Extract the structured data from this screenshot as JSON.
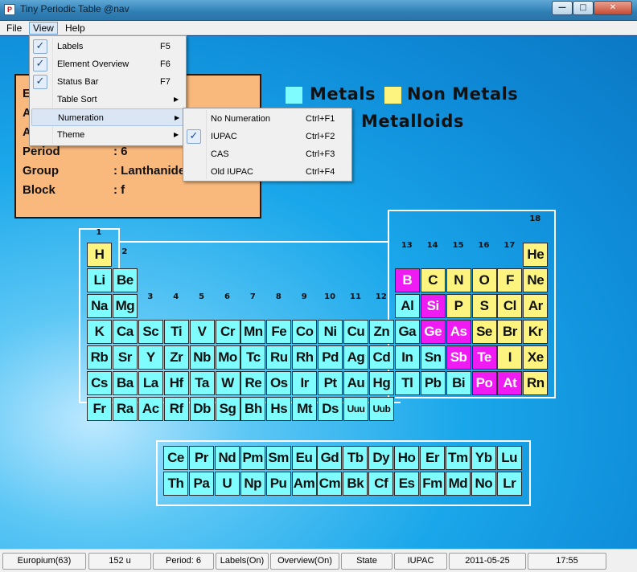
{
  "window": {
    "title": "Tiny Periodic Table   @nav",
    "app_icon": "P",
    "min": "—",
    "max": "□",
    "close": "✕"
  },
  "menubar": {
    "file": "File",
    "view": "View",
    "help": "Help"
  },
  "view_menu": [
    {
      "label": "Labels",
      "shortcut": "F5",
      "checked": true,
      "submenu": false
    },
    {
      "label": "Element Overview",
      "shortcut": "F6",
      "checked": true,
      "submenu": false
    },
    {
      "label": "Status Bar",
      "shortcut": "F7",
      "checked": true,
      "submenu": false
    },
    {
      "label": "Table Sort",
      "shortcut": "",
      "checked": false,
      "submenu": true
    },
    {
      "label": "Numeration",
      "shortcut": "",
      "checked": false,
      "submenu": true,
      "highlighted": true
    },
    {
      "label": "Theme",
      "shortcut": "",
      "checked": false,
      "submenu": true
    }
  ],
  "numeration_menu": [
    {
      "label": "No Numeration",
      "shortcut": "Ctrl+F1",
      "checked": false
    },
    {
      "label": "IUPAC",
      "shortcut": "Ctrl+F2",
      "checked": true
    },
    {
      "label": "CAS",
      "shortcut": "Ctrl+F3",
      "checked": false
    },
    {
      "label": "Old IUPAC",
      "shortcut": "Ctrl+F4",
      "checked": false
    }
  ],
  "info_panel": {
    "rows": [
      {
        "key": "E",
        "value": ""
      },
      {
        "key": "A",
        "value": ""
      },
      {
        "key": "A",
        "value": ""
      },
      {
        "key": "Period",
        "value": ": 6"
      },
      {
        "key": "Group",
        "value": ": Lanthanide"
      },
      {
        "key": "Block",
        "value": ": f"
      }
    ]
  },
  "legend": {
    "metals": "Metals",
    "nonmetals": "Non Metals",
    "metalloids": "Metalloids",
    "colors": {
      "metal": "#7ffcfd",
      "nonmetal": "#fcf47f",
      "metalloid": "#ee1cf3"
    }
  },
  "group_numbers": [
    "1",
    "2",
    "3",
    "4",
    "5",
    "6",
    "7",
    "8",
    "9",
    "10",
    "11",
    "12",
    "13",
    "14",
    "15",
    "16",
    "17",
    "18"
  ],
  "periodic_table": [
    {
      "symbol": "H",
      "group": 1,
      "period": 1,
      "category": "nonmetal"
    },
    {
      "symbol": "He",
      "group": 18,
      "period": 1,
      "category": "nonmetal"
    },
    {
      "symbol": "Li",
      "group": 1,
      "period": 2,
      "category": "metal"
    },
    {
      "symbol": "Be",
      "group": 2,
      "period": 2,
      "category": "metal"
    },
    {
      "symbol": "B",
      "group": 13,
      "period": 2,
      "category": "metalloid"
    },
    {
      "symbol": "C",
      "group": 14,
      "period": 2,
      "category": "nonmetal"
    },
    {
      "symbol": "N",
      "group": 15,
      "period": 2,
      "category": "nonmetal"
    },
    {
      "symbol": "O",
      "group": 16,
      "period": 2,
      "category": "nonmetal"
    },
    {
      "symbol": "F",
      "group": 17,
      "period": 2,
      "category": "nonmetal"
    },
    {
      "symbol": "Ne",
      "group": 18,
      "period": 2,
      "category": "nonmetal"
    },
    {
      "symbol": "Na",
      "group": 1,
      "period": 3,
      "category": "metal"
    },
    {
      "symbol": "Mg",
      "group": 2,
      "period": 3,
      "category": "metal"
    },
    {
      "symbol": "Al",
      "group": 13,
      "period": 3,
      "category": "metal"
    },
    {
      "symbol": "Si",
      "group": 14,
      "period": 3,
      "category": "metalloid"
    },
    {
      "symbol": "P",
      "group": 15,
      "period": 3,
      "category": "nonmetal"
    },
    {
      "symbol": "S",
      "group": 16,
      "period": 3,
      "category": "nonmetal"
    },
    {
      "symbol": "Cl",
      "group": 17,
      "period": 3,
      "category": "nonmetal"
    },
    {
      "symbol": "Ar",
      "group": 18,
      "period": 3,
      "category": "nonmetal"
    },
    {
      "symbol": "K",
      "group": 1,
      "period": 4,
      "category": "metal"
    },
    {
      "symbol": "Ca",
      "group": 2,
      "period": 4,
      "category": "metal"
    },
    {
      "symbol": "Sc",
      "group": 3,
      "period": 4,
      "category": "metal"
    },
    {
      "symbol": "Ti",
      "group": 4,
      "period": 4,
      "category": "metal"
    },
    {
      "symbol": "V",
      "group": 5,
      "period": 4,
      "category": "metal"
    },
    {
      "symbol": "Cr",
      "group": 6,
      "period": 4,
      "category": "metal"
    },
    {
      "symbol": "Mn",
      "group": 7,
      "period": 4,
      "category": "metal"
    },
    {
      "symbol": "Fe",
      "group": 8,
      "period": 4,
      "category": "metal"
    },
    {
      "symbol": "Co",
      "group": 9,
      "period": 4,
      "category": "metal"
    },
    {
      "symbol": "Ni",
      "group": 10,
      "period": 4,
      "category": "metal"
    },
    {
      "symbol": "Cu",
      "group": 11,
      "period": 4,
      "category": "metal"
    },
    {
      "symbol": "Zn",
      "group": 12,
      "period": 4,
      "category": "metal"
    },
    {
      "symbol": "Ga",
      "group": 13,
      "period": 4,
      "category": "metal"
    },
    {
      "symbol": "Ge",
      "group": 14,
      "period": 4,
      "category": "metalloid"
    },
    {
      "symbol": "As",
      "group": 15,
      "period": 4,
      "category": "metalloid"
    },
    {
      "symbol": "Se",
      "group": 16,
      "period": 4,
      "category": "nonmetal"
    },
    {
      "symbol": "Br",
      "group": 17,
      "period": 4,
      "category": "nonmetal"
    },
    {
      "symbol": "Kr",
      "group": 18,
      "period": 4,
      "category": "nonmetal"
    },
    {
      "symbol": "Rb",
      "group": 1,
      "period": 5,
      "category": "metal"
    },
    {
      "symbol": "Sr",
      "group": 2,
      "period": 5,
      "category": "metal"
    },
    {
      "symbol": "Y",
      "group": 3,
      "period": 5,
      "category": "metal"
    },
    {
      "symbol": "Zr",
      "group": 4,
      "period": 5,
      "category": "metal"
    },
    {
      "symbol": "Nb",
      "group": 5,
      "period": 5,
      "category": "metal"
    },
    {
      "symbol": "Mo",
      "group": 6,
      "period": 5,
      "category": "metal"
    },
    {
      "symbol": "Tc",
      "group": 7,
      "period": 5,
      "category": "metal"
    },
    {
      "symbol": "Ru",
      "group": 8,
      "period": 5,
      "category": "metal"
    },
    {
      "symbol": "Rh",
      "group": 9,
      "period": 5,
      "category": "metal"
    },
    {
      "symbol": "Pd",
      "group": 10,
      "period": 5,
      "category": "metal"
    },
    {
      "symbol": "Ag",
      "group": 11,
      "period": 5,
      "category": "metal"
    },
    {
      "symbol": "Cd",
      "group": 12,
      "period": 5,
      "category": "metal"
    },
    {
      "symbol": "In",
      "group": 13,
      "period": 5,
      "category": "metal"
    },
    {
      "symbol": "Sn",
      "group": 14,
      "period": 5,
      "category": "metal"
    },
    {
      "symbol": "Sb",
      "group": 15,
      "period": 5,
      "category": "metalloid"
    },
    {
      "symbol": "Te",
      "group": 16,
      "period": 5,
      "category": "metalloid"
    },
    {
      "symbol": "I",
      "group": 17,
      "period": 5,
      "category": "nonmetal"
    },
    {
      "symbol": "Xe",
      "group": 18,
      "period": 5,
      "category": "nonmetal"
    },
    {
      "symbol": "Cs",
      "group": 1,
      "period": 6,
      "category": "metal"
    },
    {
      "symbol": "Ba",
      "group": 2,
      "period": 6,
      "category": "metal"
    },
    {
      "symbol": "La",
      "group": 3,
      "period": 6,
      "category": "metal"
    },
    {
      "symbol": "Hf",
      "group": 4,
      "period": 6,
      "category": "metal"
    },
    {
      "symbol": "Ta",
      "group": 5,
      "period": 6,
      "category": "metal"
    },
    {
      "symbol": "W",
      "group": 6,
      "period": 6,
      "category": "metal"
    },
    {
      "symbol": "Re",
      "group": 7,
      "period": 6,
      "category": "metal"
    },
    {
      "symbol": "Os",
      "group": 8,
      "period": 6,
      "category": "metal"
    },
    {
      "symbol": "Ir",
      "group": 9,
      "period": 6,
      "category": "metal"
    },
    {
      "symbol": "Pt",
      "group": 10,
      "period": 6,
      "category": "metal"
    },
    {
      "symbol": "Au",
      "group": 11,
      "period": 6,
      "category": "metal"
    },
    {
      "symbol": "Hg",
      "group": 12,
      "period": 6,
      "category": "metal"
    },
    {
      "symbol": "Tl",
      "group": 13,
      "period": 6,
      "category": "metal"
    },
    {
      "symbol": "Pb",
      "group": 14,
      "period": 6,
      "category": "metal"
    },
    {
      "symbol": "Bi",
      "group": 15,
      "period": 6,
      "category": "metal"
    },
    {
      "symbol": "Po",
      "group": 16,
      "period": 6,
      "category": "metalloid"
    },
    {
      "symbol": "At",
      "group": 17,
      "period": 6,
      "category": "metalloid"
    },
    {
      "symbol": "Rn",
      "group": 18,
      "period": 6,
      "category": "nonmetal"
    },
    {
      "symbol": "Fr",
      "group": 1,
      "period": 7,
      "category": "metal"
    },
    {
      "symbol": "Ra",
      "group": 2,
      "period": 7,
      "category": "metal"
    },
    {
      "symbol": "Ac",
      "group": 3,
      "period": 7,
      "category": "metal"
    },
    {
      "symbol": "Rf",
      "group": 4,
      "period": 7,
      "category": "metal"
    },
    {
      "symbol": "Db",
      "group": 5,
      "period": 7,
      "category": "metal"
    },
    {
      "symbol": "Sg",
      "group": 6,
      "period": 7,
      "category": "metal"
    },
    {
      "symbol": "Bh",
      "group": 7,
      "period": 7,
      "category": "metal"
    },
    {
      "symbol": "Hs",
      "group": 8,
      "period": 7,
      "category": "metal"
    },
    {
      "symbol": "Mt",
      "group": 9,
      "period": 7,
      "category": "metal"
    },
    {
      "symbol": "Ds",
      "group": 10,
      "period": 7,
      "category": "metal"
    },
    {
      "symbol": "Uuu",
      "group": 11,
      "period": 7,
      "category": "metal"
    },
    {
      "symbol": "Uub",
      "group": 12,
      "period": 7,
      "category": "metal"
    }
  ],
  "f_block": {
    "lanthanides": [
      "Ce",
      "Pr",
      "Nd",
      "Pm",
      "Sm",
      "Eu",
      "Gd",
      "Tb",
      "Dy",
      "Ho",
      "Er",
      "Tm",
      "Yb",
      "Lu"
    ],
    "actinides": [
      "Th",
      "Pa",
      "U",
      "Np",
      "Pu",
      "Am",
      "Cm",
      "Bk",
      "Cf",
      "Es",
      "Fm",
      "Md",
      "No",
      "Lr"
    ]
  },
  "statusbar": [
    "Europium(63)",
    "152 u",
    "Period: 6",
    "Labels(On)",
    "Overview(On)",
    "State",
    "IUPAC",
    "2011-05-25",
    "17:55"
  ]
}
